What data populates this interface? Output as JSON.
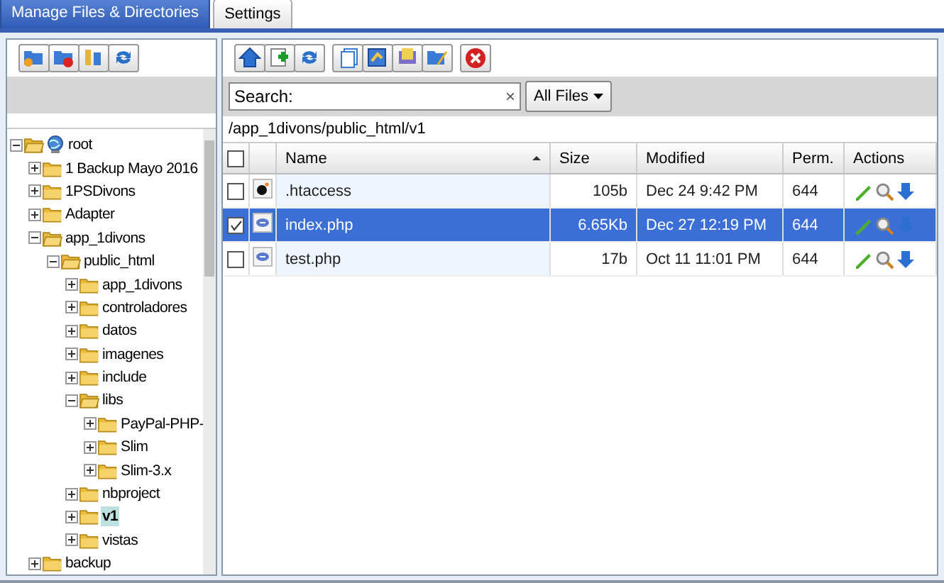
{
  "tabs": [
    {
      "label": "Manage Files & Directories",
      "selected": true
    },
    {
      "label": "Settings",
      "selected": false
    }
  ],
  "tree": {
    "label": "root",
    "kind": "root",
    "expanded": true,
    "selected": false,
    "children": [
      {
        "label": "1 Backup Mayo 2016",
        "expanded": false,
        "selected": false
      },
      {
        "label": "1PSDivons",
        "expanded": false,
        "selected": false
      },
      {
        "label": "Adapter",
        "expanded": false,
        "selected": false
      },
      {
        "label": "app_1divons",
        "expanded": true,
        "selected": false,
        "children": [
          {
            "label": "public_html",
            "expanded": true,
            "selected": false,
            "children": [
              {
                "label": "app_1divons",
                "expanded": false,
                "selected": false
              },
              {
                "label": "controladores",
                "expanded": false,
                "selected": false
              },
              {
                "label": "datos",
                "expanded": false,
                "selected": false
              },
              {
                "label": "imagenes",
                "expanded": false,
                "selected": false
              },
              {
                "label": "include",
                "expanded": false,
                "selected": false
              },
              {
                "label": "libs",
                "expanded": true,
                "selected": false,
                "children": [
                  {
                    "label": "PayPal-PHP-",
                    "expanded": false,
                    "selected": false
                  },
                  {
                    "label": "Slim",
                    "expanded": false,
                    "selected": false
                  },
                  {
                    "label": "Slim-3.x",
                    "expanded": false,
                    "selected": false
                  }
                ]
              },
              {
                "label": "nbproject",
                "expanded": false,
                "selected": false
              },
              {
                "label": "v1",
                "expanded": false,
                "selected": true
              },
              {
                "label": "vistas",
                "expanded": false,
                "selected": false
              }
            ]
          }
        ]
      },
      {
        "label": "backup",
        "expanded": false,
        "selected": false
      }
    ]
  },
  "search": {
    "label": "Search:",
    "clear": "×"
  },
  "filter": {
    "label": "All Files"
  },
  "path": "/app_1divons/public_html/v1",
  "table": {
    "all_checked": false,
    "columns": [
      "Name",
      "Size",
      "Modified",
      "Perm.",
      "Actions"
    ],
    "rows": [
      {
        "kind": "config",
        "name": ".htaccess",
        "size": "105b",
        "modified": "Dec 24 9:42 PM",
        "perm": "644",
        "checked": false,
        "selected": false
      },
      {
        "kind": "php",
        "name": "index.php",
        "size": "6.65Kb",
        "modified": "Dec 27 12:19 PM",
        "perm": "644",
        "checked": true,
        "selected": true
      },
      {
        "kind": "php",
        "name": "test.php",
        "size": "17b",
        "modified": "Oct 11 11:01 PM",
        "perm": "644",
        "checked": false,
        "selected": false
      }
    ]
  }
}
